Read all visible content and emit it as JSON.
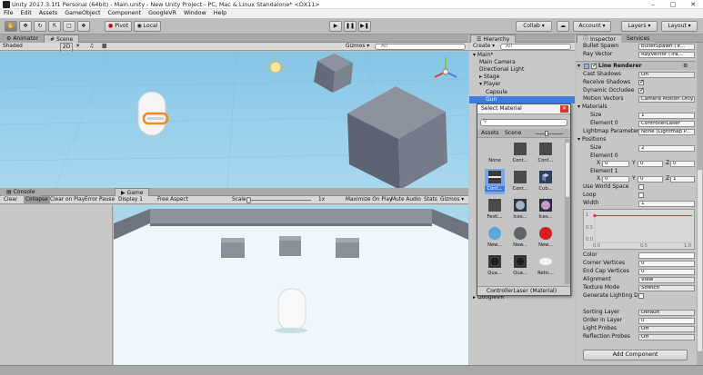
{
  "window": {
    "title": "Unity 2017.3.1f1 Personal (64bit) - Main.unity - New Unity Project - PC, Mac & Linux Standalone* <DX11>",
    "controls": [
      "–",
      "□",
      "✕"
    ]
  },
  "menu": [
    "File",
    "Edit",
    "Assets",
    "GameObject",
    "Component",
    "GoogleVR",
    "Window",
    "Help"
  ],
  "toolbar": {
    "pivot": "Pivot",
    "local": "Local",
    "collab": "Collab ▾",
    "account": "Account ▾",
    "layers": "Layers ▾",
    "layout": "Layout ▾"
  },
  "scene_panel": {
    "tabs": [
      "Animator",
      "Scene"
    ],
    "shading": "Shaded",
    "mode_2d": "2D",
    "gizmos": "Gizmos ▾",
    "search_placeholder": "All"
  },
  "console_panel": {
    "tabs": [
      "Console",
      "Game"
    ],
    "buttons": [
      "Clear",
      "Collapse",
      "Clear on Play",
      "Error Pause"
    ]
  },
  "game_panel": {
    "display": "Display 1",
    "aspect": "Free Aspect",
    "scale_label": "Scale",
    "scale_value": "1x",
    "buttons": [
      "Maximize On Play",
      "Mute Audio",
      "Stats",
      "Gizmos ▾"
    ]
  },
  "hierarchy": {
    "tab": "Hierarchy",
    "create": "Create ▾",
    "search_placeholder": "All",
    "items": [
      {
        "label": "Main*",
        "indent": 0,
        "expanded": true,
        "selected": false
      },
      {
        "label": "Main Camera",
        "indent": 1,
        "expanded": null,
        "selected": false
      },
      {
        "label": "Directional Light",
        "indent": 1,
        "expanded": null,
        "selected": false
      },
      {
        "label": "Stage",
        "indent": 1,
        "expanded": false,
        "selected": false
      },
      {
        "label": "Player",
        "indent": 1,
        "expanded": true,
        "selected": false
      },
      {
        "label": "Capsule",
        "indent": 2,
        "expanded": null,
        "selected": false
      },
      {
        "label": "Gun",
        "indent": 2,
        "expanded": null,
        "selected": true
      }
    ],
    "bottom_item": "GoogleVR"
  },
  "select_material": {
    "title": "Select Material",
    "tabs": [
      "Assets",
      "Scene"
    ],
    "items": [
      {
        "label": "None",
        "kind": "none"
      },
      {
        "label": "Cont...",
        "kind": "dark"
      },
      {
        "label": "Cont...",
        "kind": "dark"
      },
      {
        "label": "Cont...",
        "kind": "stripe",
        "selected": true
      },
      {
        "label": "Cont...",
        "kind": "dark"
      },
      {
        "label": "Cub...",
        "kind": "cube"
      },
      {
        "label": "Festi...",
        "kind": "dark"
      },
      {
        "label": "Ices...",
        "kind": "ice"
      },
      {
        "label": "Ices...",
        "kind": "ice2"
      },
      {
        "label": "New...",
        "kind": "sphere-blue"
      },
      {
        "label": "New...",
        "kind": "sphere-grey"
      },
      {
        "label": "New...",
        "kind": "sphere-red"
      },
      {
        "label": "Qua...",
        "kind": "round-dark"
      },
      {
        "label": "Qua...",
        "kind": "round-dark"
      },
      {
        "label": "Retic...",
        "kind": "reticle"
      }
    ],
    "footer": [
      "ControllerLaser",
      "(Material)"
    ]
  },
  "inspector": {
    "tabs": [
      "Inspector",
      "Services"
    ],
    "bullet_spawn_label": "Bullet Spawn",
    "bullet_spawn_value": "bulletSpawn (Tr...",
    "ray_vector_label": "Ray Vector",
    "ray_vector_value": "RayVector (Tra...",
    "component_title": "Line Renderer",
    "rows": [
      {
        "label": "Cast Shadows",
        "value": "On"
      },
      {
        "label": "Receive Shadows",
        "check": true
      },
      {
        "label": "Dynamic Occludee",
        "check": true
      },
      {
        "label": "Motion Vectors",
        "value": "Camera Motion Only"
      }
    ],
    "materials_label": "Materials",
    "size_label": "Size",
    "materials_size": "1",
    "element0_label": "Element 0",
    "element0_value": "ControllerLaser",
    "lightmap_label": "Lightmap Parameter",
    "lightmap_value": "None (Lightmap P...",
    "positions_label": "Positions",
    "positions_size": "2",
    "pos_element0_label": "Element 0",
    "pos_element0": {
      "x": "0",
      "y": "0",
      "z": "0"
    },
    "pos_element1_label": "Element 1",
    "pos_element1": {
      "x": "0",
      "y": "0",
      "z": "1"
    },
    "axis_labels": {
      "x": "X",
      "y": "Y",
      "z": "Z"
    },
    "use_world_space_label": "Use World Space",
    "loop_label": "Loop",
    "width_label": "Width",
    "width_value": "1",
    "curve_ticks": {
      "y": [
        "1",
        "0.5",
        "0.0"
      ],
      "x": [
        "0.0",
        "0.5",
        "1.0"
      ]
    },
    "curve_value": 0.95,
    "color_label": "Color",
    "corner_label": "Corner Vertices",
    "corner_value": "0",
    "endcap_label": "End Cap Vertices",
    "endcap_value": "0",
    "alignment_label": "Alignment",
    "alignment_value": "View",
    "texture_label": "Texture Mode",
    "texture_value": "Stretch",
    "gen_lighting_label": "Generate Lighting Da",
    "sorting_layer_label": "Sorting Layer",
    "sorting_layer_value": "Default",
    "order_label": "Order in Layer",
    "order_value": "0",
    "light_probes_label": "Light Probes",
    "light_probes_value": "Off",
    "reflection_label": "Reflection Probes",
    "reflection_value": "Off",
    "add_component": "Add Component"
  },
  "colors": {
    "sky": "#8fcbe8",
    "selection": "#3e7de0",
    "curve": "#e03030"
  }
}
